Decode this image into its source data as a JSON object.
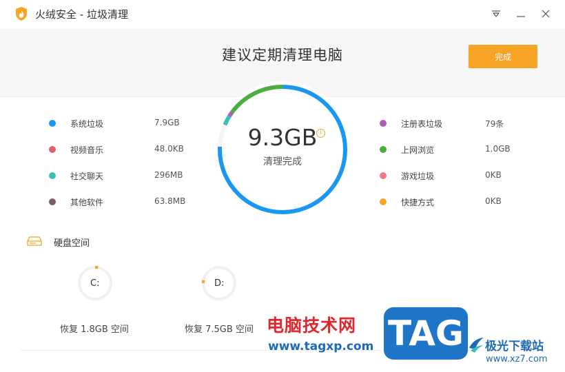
{
  "window": {
    "title": "火绒安全 - 垃圾清理",
    "logo_icon": "flame-logo-icon",
    "menu_icon": "dropdown-menu-icon",
    "minimize_icon": "minimize-icon",
    "close_icon": "close-icon"
  },
  "header": {
    "headline": "建议定期清理电脑",
    "done_label": "完成"
  },
  "gauge": {
    "value": "9.3GB",
    "info_glyph": "i",
    "label": "清理完成",
    "ring_segments": [
      {
        "color": "#1a97f0",
        "fraction": 0.757
      },
      {
        "color": "#f4f4f4",
        "fraction": 0.057
      },
      {
        "color": "#3cbfb2",
        "fraction": 0.025
      },
      {
        "color": "#b05db8",
        "fraction": 0.012
      },
      {
        "color": "#4cae3e",
        "fraction": 0.149
      }
    ]
  },
  "categories_left": [
    {
      "name": "系统垃圾",
      "value": "7.9GB",
      "color": "#1a97f0"
    },
    {
      "name": "视频音乐",
      "value": "48.0KB",
      "color": "#e0616e"
    },
    {
      "name": "社交聊天",
      "value": "296MB",
      "color": "#3cbfb2"
    },
    {
      "name": "其他软件",
      "value": "63.8MB",
      "color": "#7a5e68"
    }
  ],
  "categories_right": [
    {
      "name": "注册表垃圾",
      "value": "79条",
      "color": "#b05db8"
    },
    {
      "name": "上网浏览",
      "value": "1.0GB",
      "color": "#4cae3e"
    },
    {
      "name": "游戏垃圾",
      "value": "0KB",
      "color": "#f07a88"
    },
    {
      "name": "快捷方式",
      "value": "0KB",
      "color": "#f7a325"
    }
  ],
  "disk": {
    "section_icon": "hard-drive-icon",
    "title": "硬盘空间",
    "drives": [
      {
        "letter": "C:",
        "recover": "恢复 1.8GB 空间",
        "used_fraction": 0.03
      },
      {
        "letter": "D:",
        "recover": "恢复 7.5GB 空间",
        "used_fraction": 0.03
      }
    ]
  },
  "watermark": {
    "cn": "电脑技术网",
    "url": "www.tagxp.com",
    "tag": "TAG",
    "site_name": "极光下载站",
    "site_url": "www.xz7.com"
  },
  "colors": {
    "accent": "#f7a325",
    "ring_track": "#f0f0f0"
  }
}
